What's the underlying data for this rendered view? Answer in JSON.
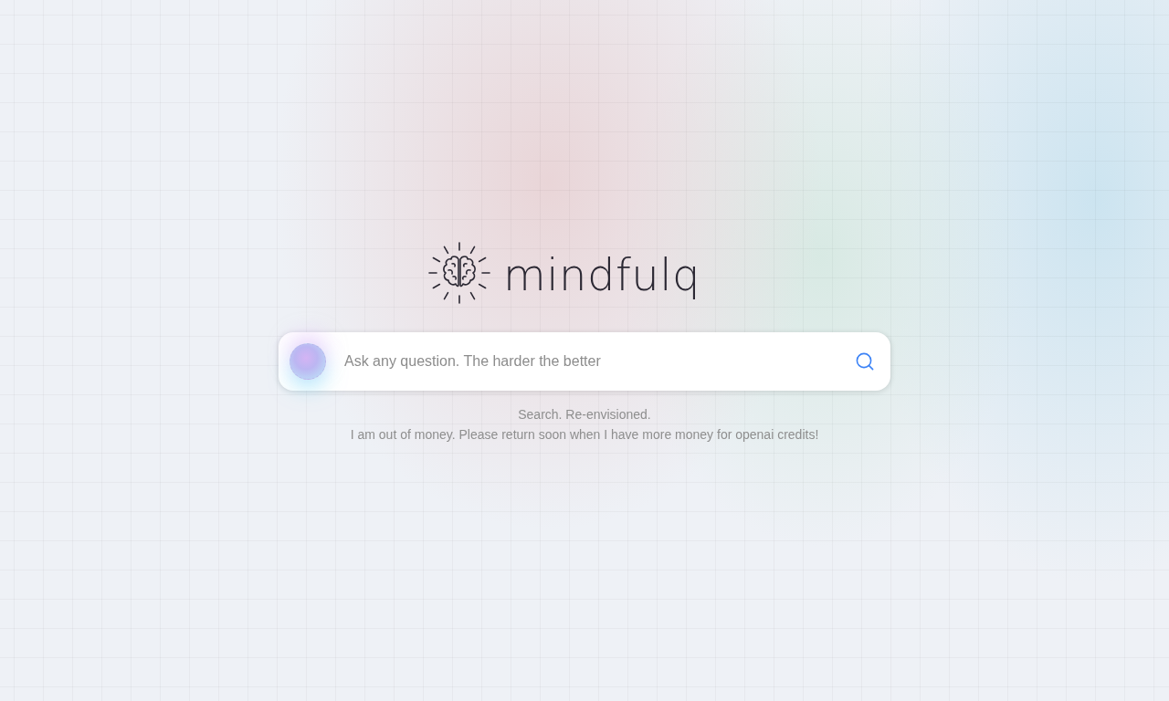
{
  "logo": {
    "wordmark": "mindfulq"
  },
  "search": {
    "placeholder": "Ask any question. The harder the better"
  },
  "tagline": "Search. Re-envisioned.",
  "notice": "I am out of money. Please return soon when I have more money for openai credits!"
}
